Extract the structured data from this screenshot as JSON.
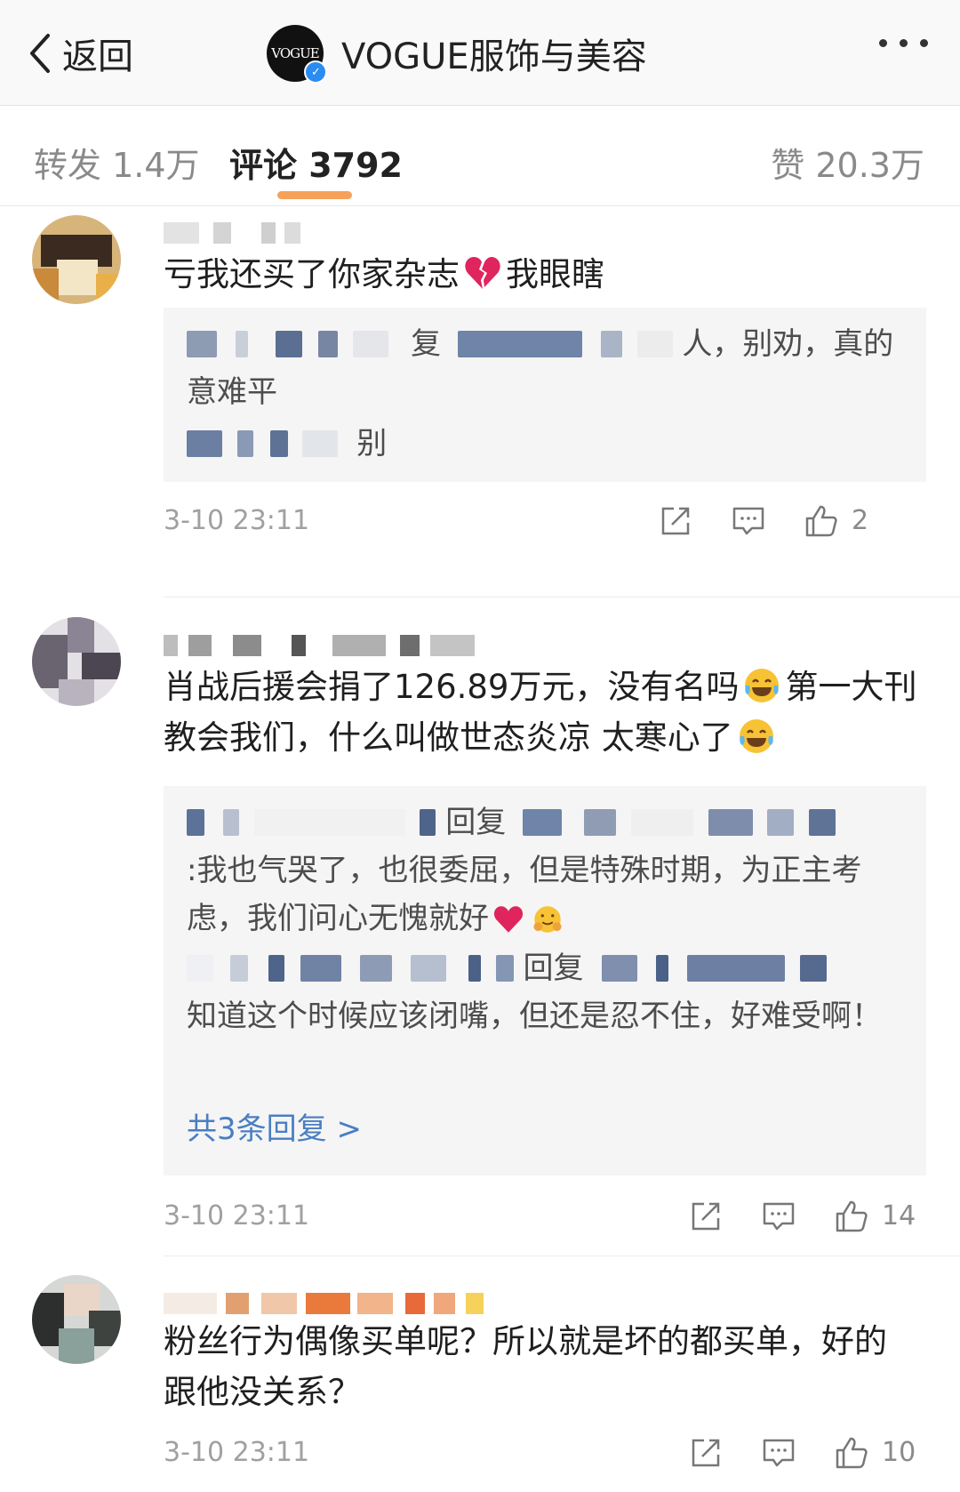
{
  "nav": {
    "back_label": "返回",
    "logo_text": "VOGUE",
    "account_name": "VOGUE服饰与美容",
    "more_icon": "more-dots-icon"
  },
  "tabs": {
    "repost": "转发 1.4万",
    "comments": "评论 3792",
    "likes": "赞 20.3万",
    "accent_color": "#f6a15a"
  },
  "comments": [
    {
      "text_a": "亏我还买了你家杂志",
      "emoji_1": "broken-heart-icon",
      "text_b": "我眼瞎",
      "replies": [
        {
          "visible_a": "复",
          "visible_b": "人，别劝，真的意难平"
        },
        {
          "visible_a": "别"
        }
      ],
      "time": "3-10 23:11",
      "likes": "2"
    },
    {
      "text_a": "肖战后援会捐了126.89万元，没有名吗",
      "emoji_1": "tears-of-joy-icon",
      "text_b": "第一大刊教会我们，什么叫做世态炎凉 太寒心了",
      "emoji_2": "tears-of-joy-icon",
      "replies": [
        {
          "visible_a": "回复",
          "visible_b": ":我也气哭了，也很委屈，但是特殊时期，为正主考虑，我们问心无愧就好",
          "emoji_a": "red-heart-icon",
          "emoji_b": "hugging-face-icon"
        },
        {
          "visible_a": "回复",
          "visible_b": "知道这个时候应该闭嘴，但还是忍不住，好难受啊！"
        }
      ],
      "more_replies": "共3条回复 >",
      "time": "3-10 23:11",
      "likes": "14"
    },
    {
      "text": "粉丝行为偶像买单呢？所以就是坏的都买单，好的跟他没关系？",
      "time": "3-10 23:11",
      "likes": "10"
    }
  ],
  "link_color": "#4a7ec2"
}
